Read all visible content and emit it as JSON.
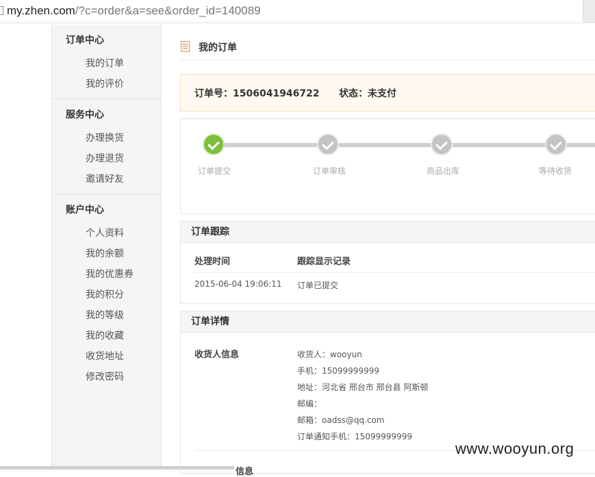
{
  "browser": {
    "url_host": "my.zhen.com",
    "url_rest": "/?c=order&a=see&order_id=140089"
  },
  "sidebar": {
    "groups": [
      {
        "title": "订单中心",
        "items": [
          "我的订单",
          "我的评价"
        ]
      },
      {
        "title": "服务中心",
        "items": [
          "办理换货",
          "办理退货",
          "邀请好友"
        ]
      },
      {
        "title": "账户中心",
        "items": [
          "个人资料",
          "我的余额",
          "我的优惠券",
          "我的积分",
          "我的等级",
          "我的收藏",
          "收货地址",
          "修改密码"
        ]
      }
    ]
  },
  "main": {
    "title": "我的订单",
    "order_no_label": "订单号：1506041946722",
    "status_label": "状态：未支付",
    "steps": [
      {
        "label": "订单提交",
        "done": true
      },
      {
        "label": "订单审核",
        "done": false
      },
      {
        "label": "商品出库",
        "done": false
      },
      {
        "label": "等待收货",
        "done": false
      }
    ],
    "tracking": {
      "title": "订单跟踪",
      "col_time": "处理时间",
      "col_record": "跟踪显示记录",
      "rows": [
        {
          "time": "2015-06-04 19:06:11",
          "record": "订单已提交"
        }
      ]
    },
    "detail": {
      "title": "订单详情",
      "receiver_label": "收货人信息",
      "receiver_lines": [
        "收货人：wooyun",
        "手机：15099999999",
        "地址：河北省 邢台市 邢台县 阿斯顿",
        "邮编：",
        "邮箱：oadss@qq.com",
        "订单通知手机：15099999999"
      ],
      "next_label": "信息"
    }
  },
  "watermark": "www.wooyun.org",
  "colors": {
    "done": "#7fbe3a",
    "pending": "#c4c4c4",
    "info_bg": "#fff9f1"
  }
}
